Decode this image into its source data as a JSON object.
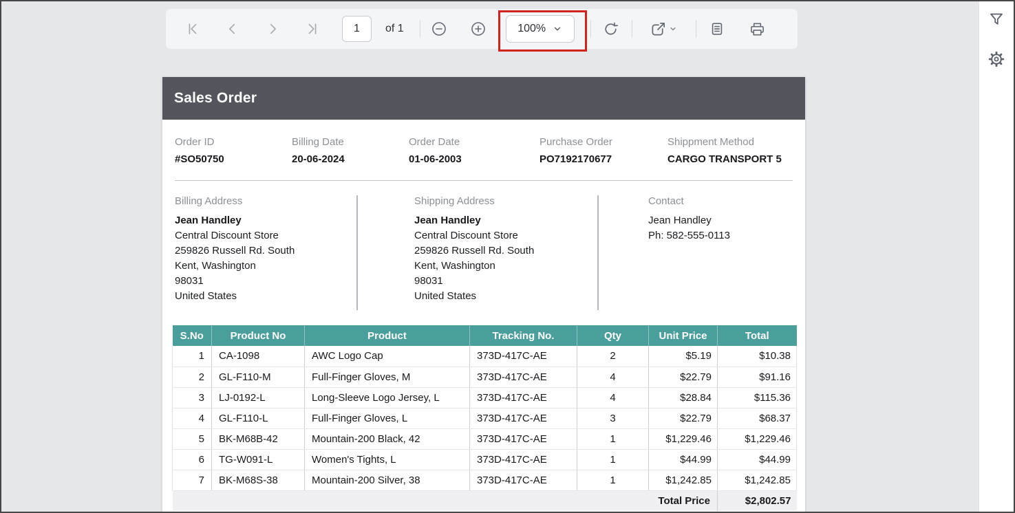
{
  "toolbar": {
    "page_value": "1",
    "page_count_label": "of 1",
    "zoom_value": "100%"
  },
  "icons": {
    "first-page": "|<",
    "previous-page": "<",
    "next-page": ">",
    "last-page": ">|",
    "zoom-out": "⊖",
    "zoom-in": "⊕",
    "chevron-down": "v",
    "refresh": "⟳",
    "export": "↗",
    "page-text": "▤",
    "print": "⎙",
    "filter": "▽",
    "settings": "⚙"
  },
  "colors": {
    "annotation_red": "#d2231d",
    "doc_header_bg": "#53575d",
    "table_header_bg": "#4a9f9c",
    "canvas_bg": "#e5e7ea",
    "footer_row_bg": "#f0f0f2"
  },
  "document": {
    "title": "Sales Order",
    "info": [
      {
        "label": "Order ID",
        "value": "#SO50750"
      },
      {
        "label": "Billing Date",
        "value": "20-06-2024"
      },
      {
        "label": "Order Date",
        "value": "01-06-2003"
      },
      {
        "label": "Purchase Order",
        "value": "PO7192170677"
      },
      {
        "label": "Shippment Method",
        "value": "CARGO TRANSPORT 5"
      }
    ],
    "billing": {
      "label": "Billing Address",
      "name": "Jean Handley",
      "lines": [
        "Central Discount Store",
        "259826 Russell Rd. South",
        "Kent, Washington",
        "98031",
        "United States"
      ]
    },
    "shipping": {
      "label": "Shipping Address",
      "name": "Jean Handley",
      "lines": [
        "Central Discount Store",
        "259826 Russell Rd. South",
        "Kent, Washington",
        "98031",
        "United States"
      ]
    },
    "contact": {
      "label": "Contact",
      "name": "Jean Handley",
      "phone": "Ph: 582-555-0113"
    },
    "table": {
      "headers": [
        "S.No",
        "Product No",
        "Product",
        "Tracking No.",
        "Qty",
        "Unit Price",
        "Total"
      ],
      "rows": [
        [
          "1",
          "CA-1098",
          "AWC Logo Cap",
          "373D-417C-AE",
          "2",
          "$5.19",
          "$10.38"
        ],
        [
          "2",
          "GL-F110-M",
          "Full-Finger Gloves, M",
          "373D-417C-AE",
          "4",
          "$22.79",
          "$91.16"
        ],
        [
          "3",
          "LJ-0192-L",
          "Long-Sleeve Logo Jersey, L",
          "373D-417C-AE",
          "4",
          "$28.84",
          "$115.36"
        ],
        [
          "4",
          "GL-F110-L",
          "Full-Finger Gloves, L",
          "373D-417C-AE",
          "3",
          "$22.79",
          "$68.37"
        ],
        [
          "5",
          "BK-M68B-42",
          "Mountain-200 Black, 42",
          "373D-417C-AE",
          "1",
          "$1,229.46",
          "$1,229.46"
        ],
        [
          "6",
          "TG-W091-L",
          "Women's Tights, L",
          "373D-417C-AE",
          "1",
          "$44.99",
          "$44.99"
        ],
        [
          "7",
          "BK-M68S-38",
          "Mountain-200 Silver, 38",
          "373D-417C-AE",
          "1",
          "$1,242.85",
          "$1,242.85"
        ]
      ],
      "footer": {
        "label": "Total Price",
        "value": "$2,802.57"
      }
    }
  }
}
